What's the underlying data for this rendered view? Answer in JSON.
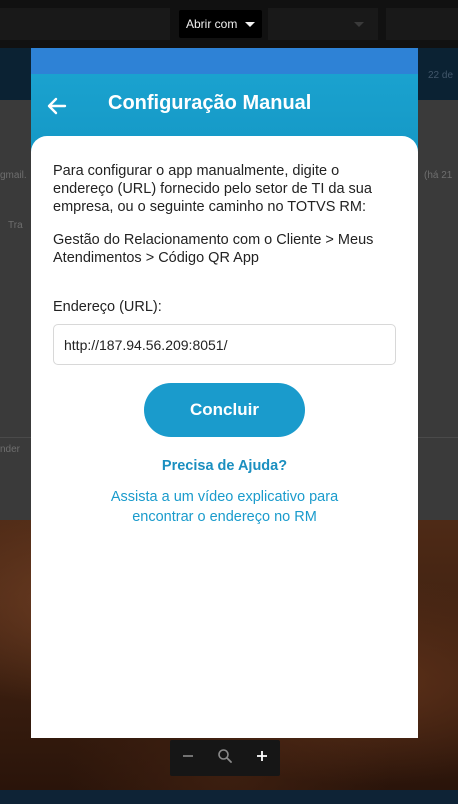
{
  "viewer": {
    "open_with_label": "Abrir com",
    "background": {
      "date_snippet": "22 de",
      "snippet_email": "gmail.",
      "snippet_time": "(há 21",
      "snippet_tra": "Tra",
      "snippet_responder": "nder"
    },
    "zoom": {
      "zoom_out_icon": "minus-icon",
      "zoom_reset_icon": "magnifier-icon",
      "zoom_in_icon": "plus-icon"
    }
  },
  "app": {
    "header": {
      "title": "Configuração Manual",
      "back_icon": "arrow-left-icon"
    },
    "body": {
      "intro": "Para configurar o app manualmente, digite o endereço (URL) fornecido pelo setor de TI da sua empresa, ou o seguinte caminho no TOTVS RM:",
      "path": "Gestão do Relacionamento com o Cliente > Meus Atendimentos > Código QR App",
      "url_label": "Endereço (URL):",
      "url_value": "http://187.94.56.209:8051/",
      "submit_label": "Concluir",
      "help_title": "Precisa de Ajuda?",
      "help_link": "Assista a um vídeo explicativo para encontrar o endereço no RM"
    }
  },
  "colors": {
    "primary": "#1a9bcc",
    "status_bar": "#2e82d6",
    "header": "#1aa2cf",
    "text": "#222222"
  }
}
